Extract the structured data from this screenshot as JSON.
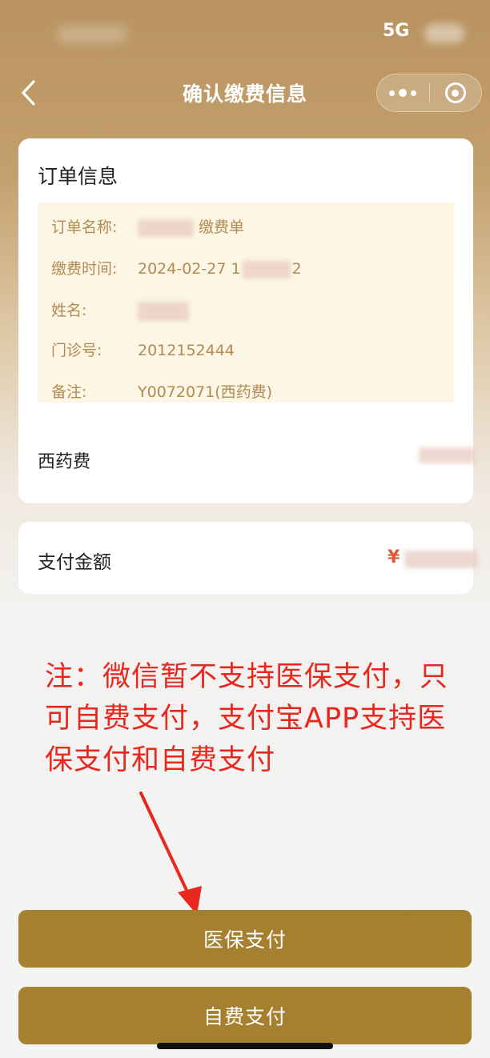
{
  "status_bar": {
    "signal_text": "5G"
  },
  "nav": {
    "title": "确认缴费信息",
    "back_icon": "chevron-left-icon",
    "menu_icon": "more-dots-icon",
    "close_icon": "target-circle-icon"
  },
  "order": {
    "title": "订单信息",
    "rows": [
      {
        "label": "订单名称:",
        "value": "缴费单"
      },
      {
        "label": "缴费时间:",
        "value": "2024-02-27 1",
        "value_tail": "2"
      },
      {
        "label": "姓名:",
        "value": ""
      },
      {
        "label": "门诊号:",
        "value": "2012152444"
      },
      {
        "label": "备注:",
        "value": "Y0072071(西药费)"
      }
    ],
    "fee_item_label": "西药费"
  },
  "payment": {
    "label": "支付金额",
    "currency": "¥"
  },
  "note": {
    "text": "注：微信暂不支持医保支付，只可自费支付，支付宝APP支持医保支付和自费支付"
  },
  "buttons": {
    "insurance": "医保支付",
    "self": "自费支付"
  },
  "colors": {
    "accent": "#a5802f",
    "note": "#e8281e",
    "info_text": "#b08b55",
    "info_bg": "#fdf6e4"
  }
}
